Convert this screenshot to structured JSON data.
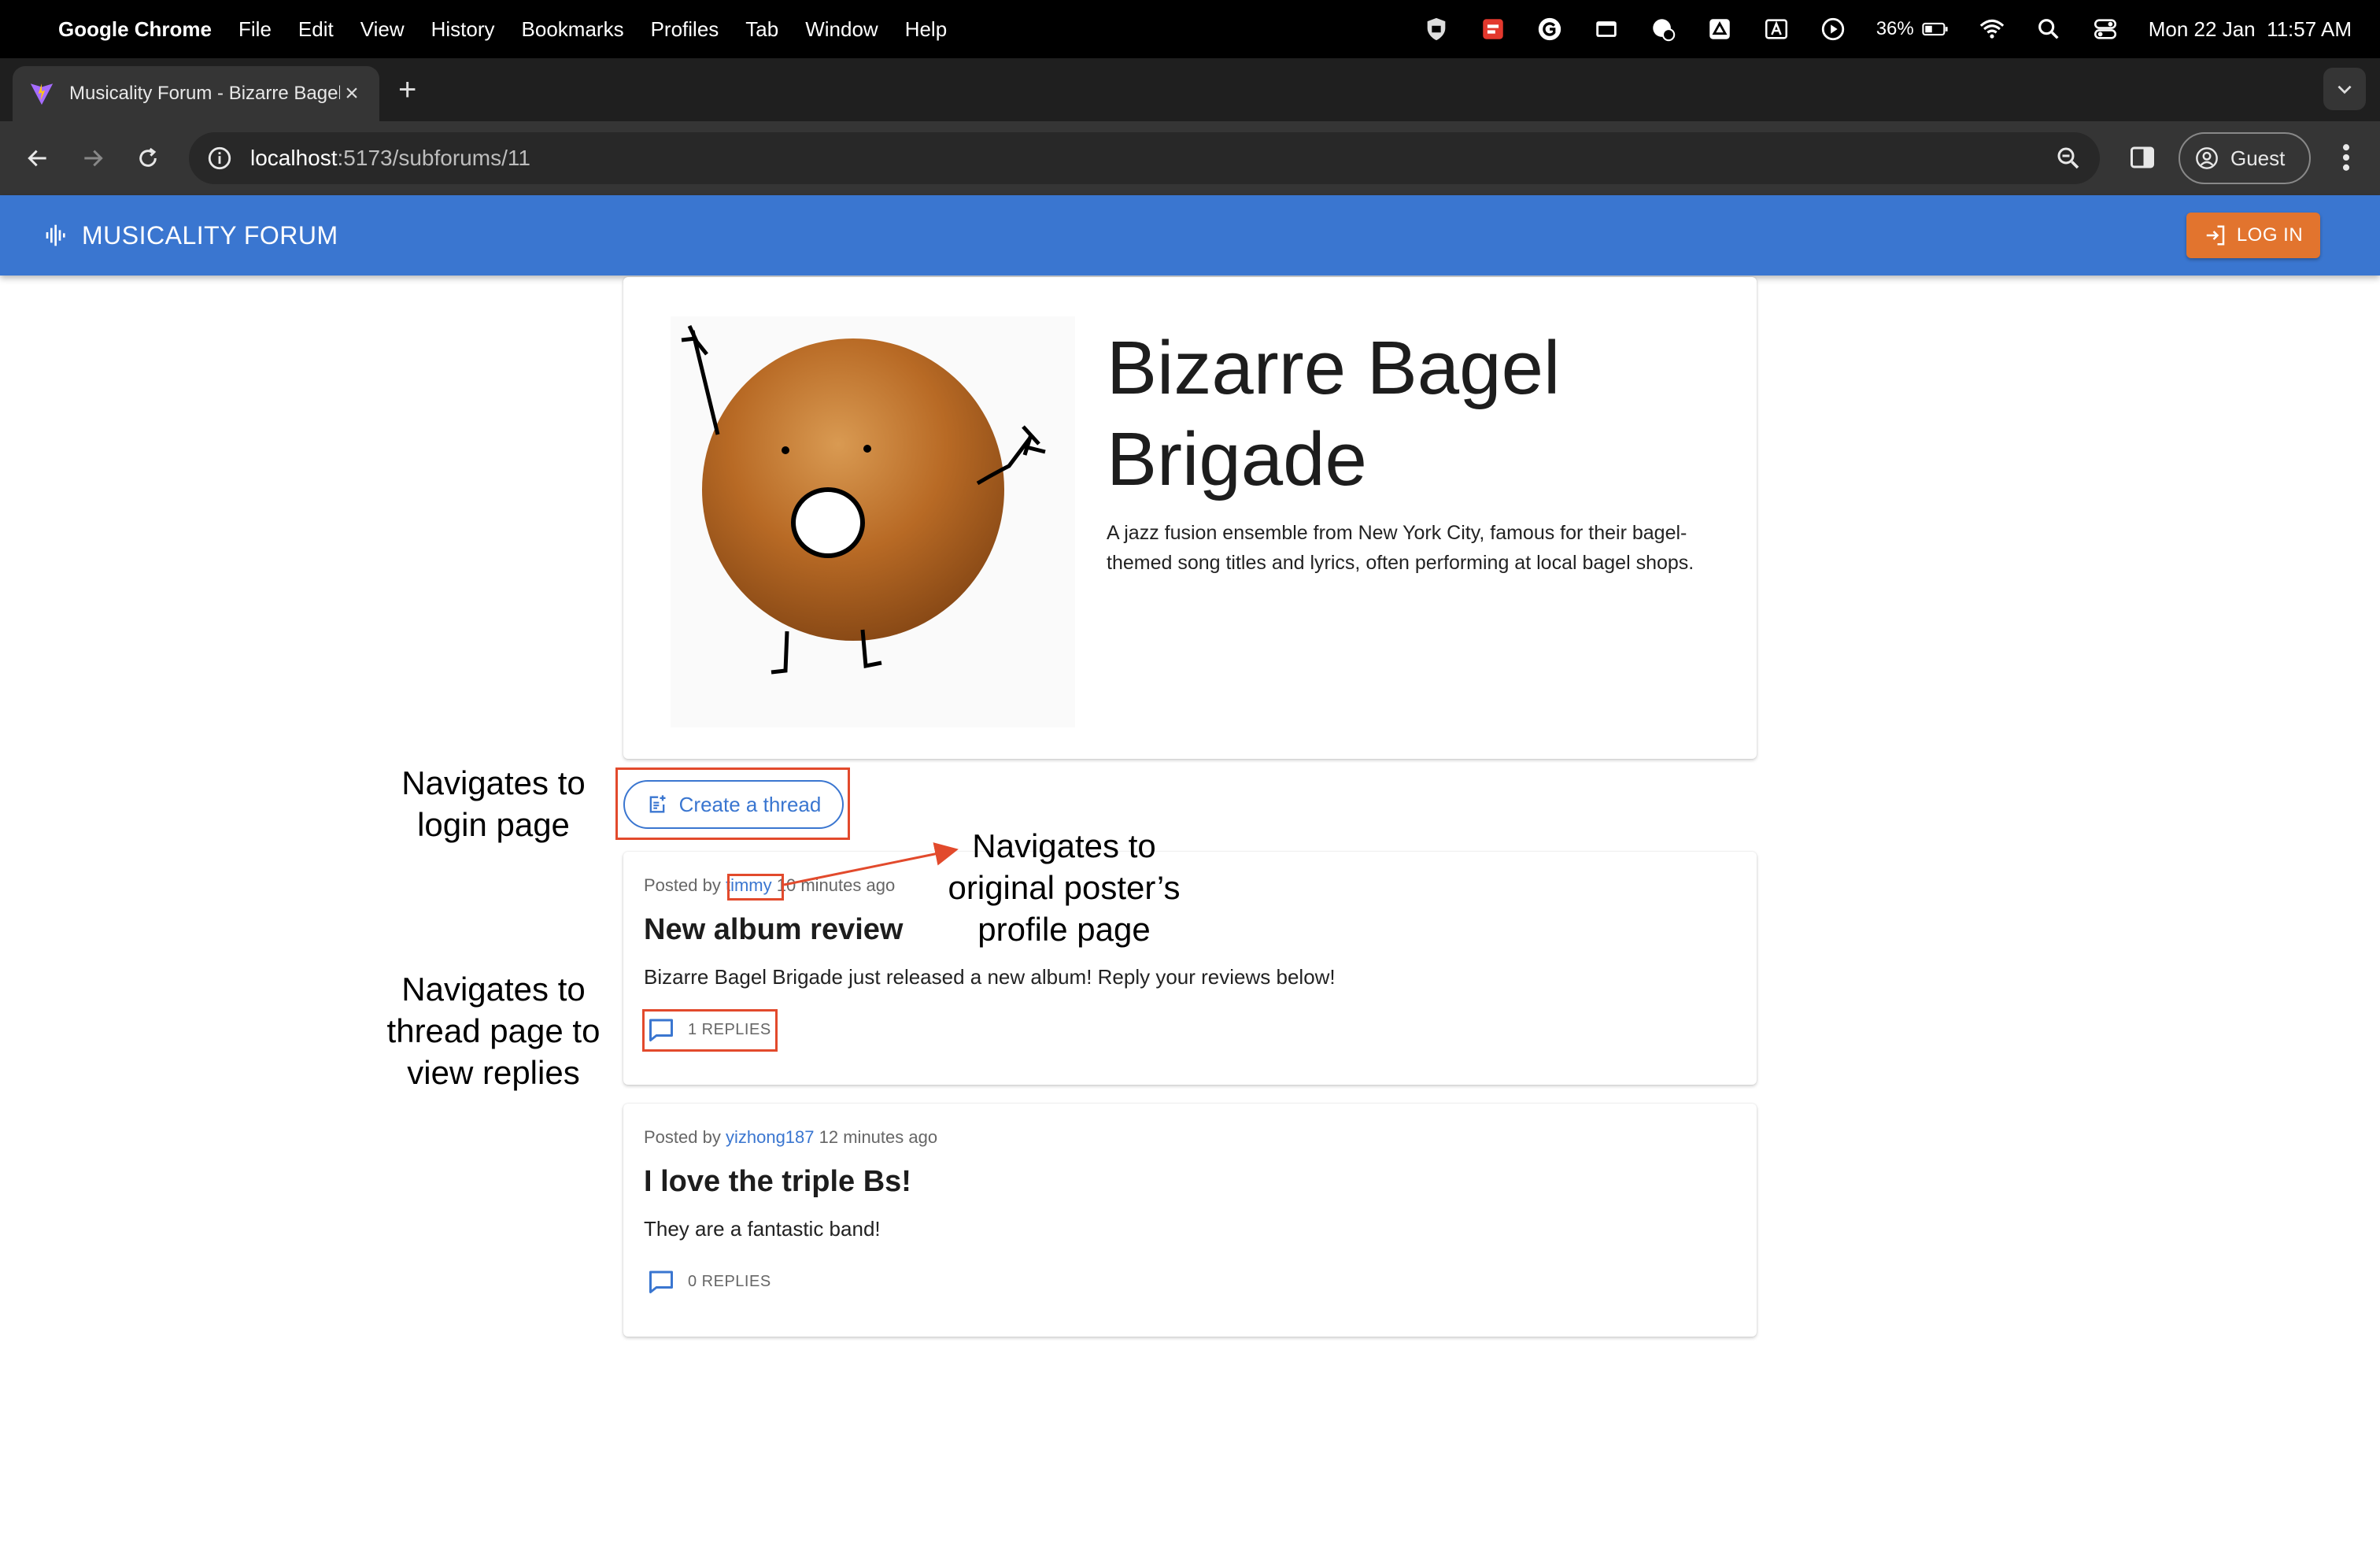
{
  "menubar": {
    "app_name": "Google Chrome",
    "items": [
      "File",
      "Edit",
      "View",
      "History",
      "Bookmarks",
      "Profiles",
      "Tab",
      "Window",
      "Help"
    ],
    "battery": "36%",
    "datetime": "Mon 22 Jan  11:57 AM"
  },
  "browser": {
    "tab_title": "Musicality Forum - Bizarre Bagel Brigade",
    "url_host": "localhost",
    "url_path": ":5173/subforums/11",
    "profile_label": "Guest"
  },
  "appbar": {
    "brand": "MUSICALITY FORUM",
    "login_label": "LOG IN",
    "color": "#3a76d0",
    "login_color": "#e2742e"
  },
  "subforum": {
    "title": "Bizarre Bagel Brigade",
    "description": "A jazz fusion ensemble from New York City, famous for their bagel-themed song titles and lyrics, often performing at local bagel shops."
  },
  "create_thread_label": "Create a thread",
  "threads": [
    {
      "posted_by_prefix": "Posted by",
      "author": "timmy",
      "time": "10 minutes ago",
      "title": "New album review",
      "body": "Bizarre Bagel Brigade just released a new album! Reply your reviews below!",
      "replies": "1 REPLIES"
    },
    {
      "posted_by_prefix": "Posted by",
      "author": "yizhong187",
      "time": "12 minutes ago",
      "title": "I love the triple Bs!",
      "body": "They are a fantastic band!",
      "replies": "0 REPLIES"
    }
  ],
  "annotations": {
    "login": [
      "Navigates to",
      "login page"
    ],
    "profile": [
      "Navigates to",
      "original poster’s",
      "profile page"
    ],
    "thread": [
      "Navigates to",
      "thread page to",
      "view replies"
    ],
    "color": "#e24a2c"
  }
}
